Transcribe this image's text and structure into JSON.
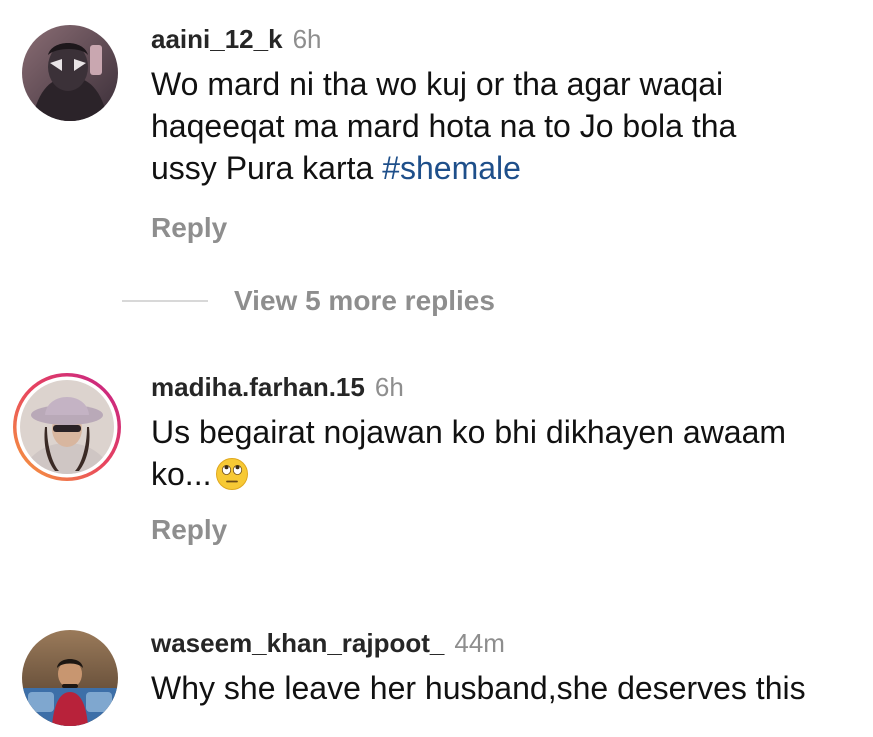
{
  "comments": [
    {
      "username": "aaini_12_k",
      "time": "6h",
      "text_lines": [
        "Wo mard ni tha wo kuj or tha agar waqai",
        "haqeeqat ma mard hota na to Jo bola tha",
        "ussy Pura karta "
      ],
      "hashtag": "#shemale",
      "reply_label": "Reply"
    },
    {
      "username": "madiha.farhan.15",
      "time": "6h",
      "text_lines": [
        "Us begairat nojawan ko bhi dikhayen awaam",
        "ko..."
      ],
      "emoji": "face-with-rolling-eyes",
      "reply_label": "Reply"
    },
    {
      "username": "waseem_khan_rajpoot_",
      "time": "44m",
      "text_lines": [
        "Why she leave her husband,she deserves this"
      ]
    }
  ],
  "view_more_replies": "View 5 more replies",
  "colors": {
    "username": "#262626",
    "secondary": "#8e8e8e",
    "hashtag": "#1e4f8a",
    "story_ring_start": "#f7a23a",
    "story_ring_end": "#d4247d"
  }
}
